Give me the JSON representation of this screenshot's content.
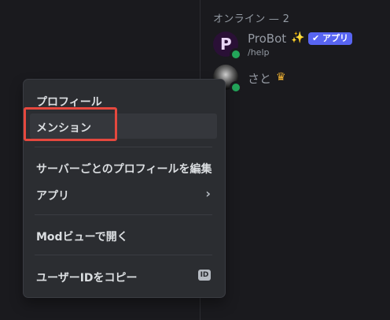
{
  "members": {
    "section_title": "オンライン — 2",
    "list": [
      {
        "name": "ProBot",
        "badge": "✔ アプリ",
        "subtitle": "/help",
        "avatar_glyph": "P",
        "status": "online"
      },
      {
        "name": "さと",
        "status": "online"
      }
    ]
  },
  "context_menu": {
    "items": [
      {
        "label": "プロフィール"
      },
      {
        "label": "メンション"
      },
      {
        "label": "サーバーごとのプロフィールを編集"
      },
      {
        "label": "アプリ"
      },
      {
        "label": "Modビューで開く"
      },
      {
        "label": "ユーザーIDをコピー",
        "badge": "ID"
      }
    ]
  },
  "colors": {
    "accent": "#5865f2",
    "online": "#23a55a",
    "highlight": "#e5483e"
  }
}
